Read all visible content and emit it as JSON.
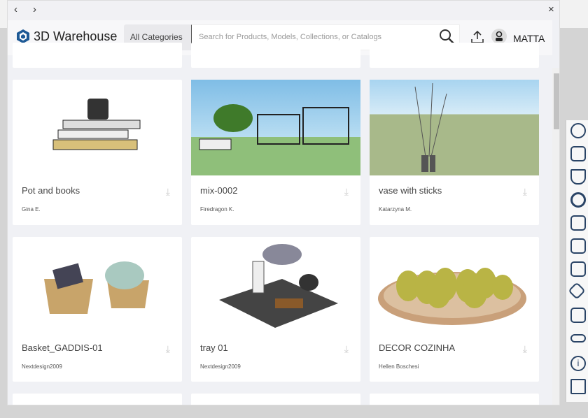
{
  "nav": {
    "back": "‹",
    "forward": "›",
    "close": "×"
  },
  "header": {
    "logo": "3D Warehouse",
    "category": "All Categories",
    "search_placeholder": "Search for Products, Models, Collections, or Catalogs",
    "user": "MATTA"
  },
  "cards": [
    {
      "title": "Pot and books",
      "author": "Gina E."
    },
    {
      "title": "mix-0002",
      "author": "Firedragon K."
    },
    {
      "title": "vase with sticks",
      "author": "Katarzyna M."
    },
    {
      "title": "Basket_GADDIS-01",
      "author": "Nextdesign2009"
    },
    {
      "title": "tray 01",
      "author": "Nextdesign2009"
    },
    {
      "title": "DECOR COZINHA",
      "author": "Hellen Boschesi"
    }
  ],
  "toolbar_icons": [
    "warehouse-search-icon",
    "outliner-icon",
    "instructor-icon",
    "warehouse-icon",
    "components-icon",
    "materials-icon",
    "styles-icon",
    "tags-icon",
    "scenes-icon",
    "shadows-glasses-icon",
    "entity-info-icon",
    "extension-warehouse-icon"
  ],
  "colors": {
    "brand": "#1e5a96",
    "background": "#f0f1f5"
  }
}
